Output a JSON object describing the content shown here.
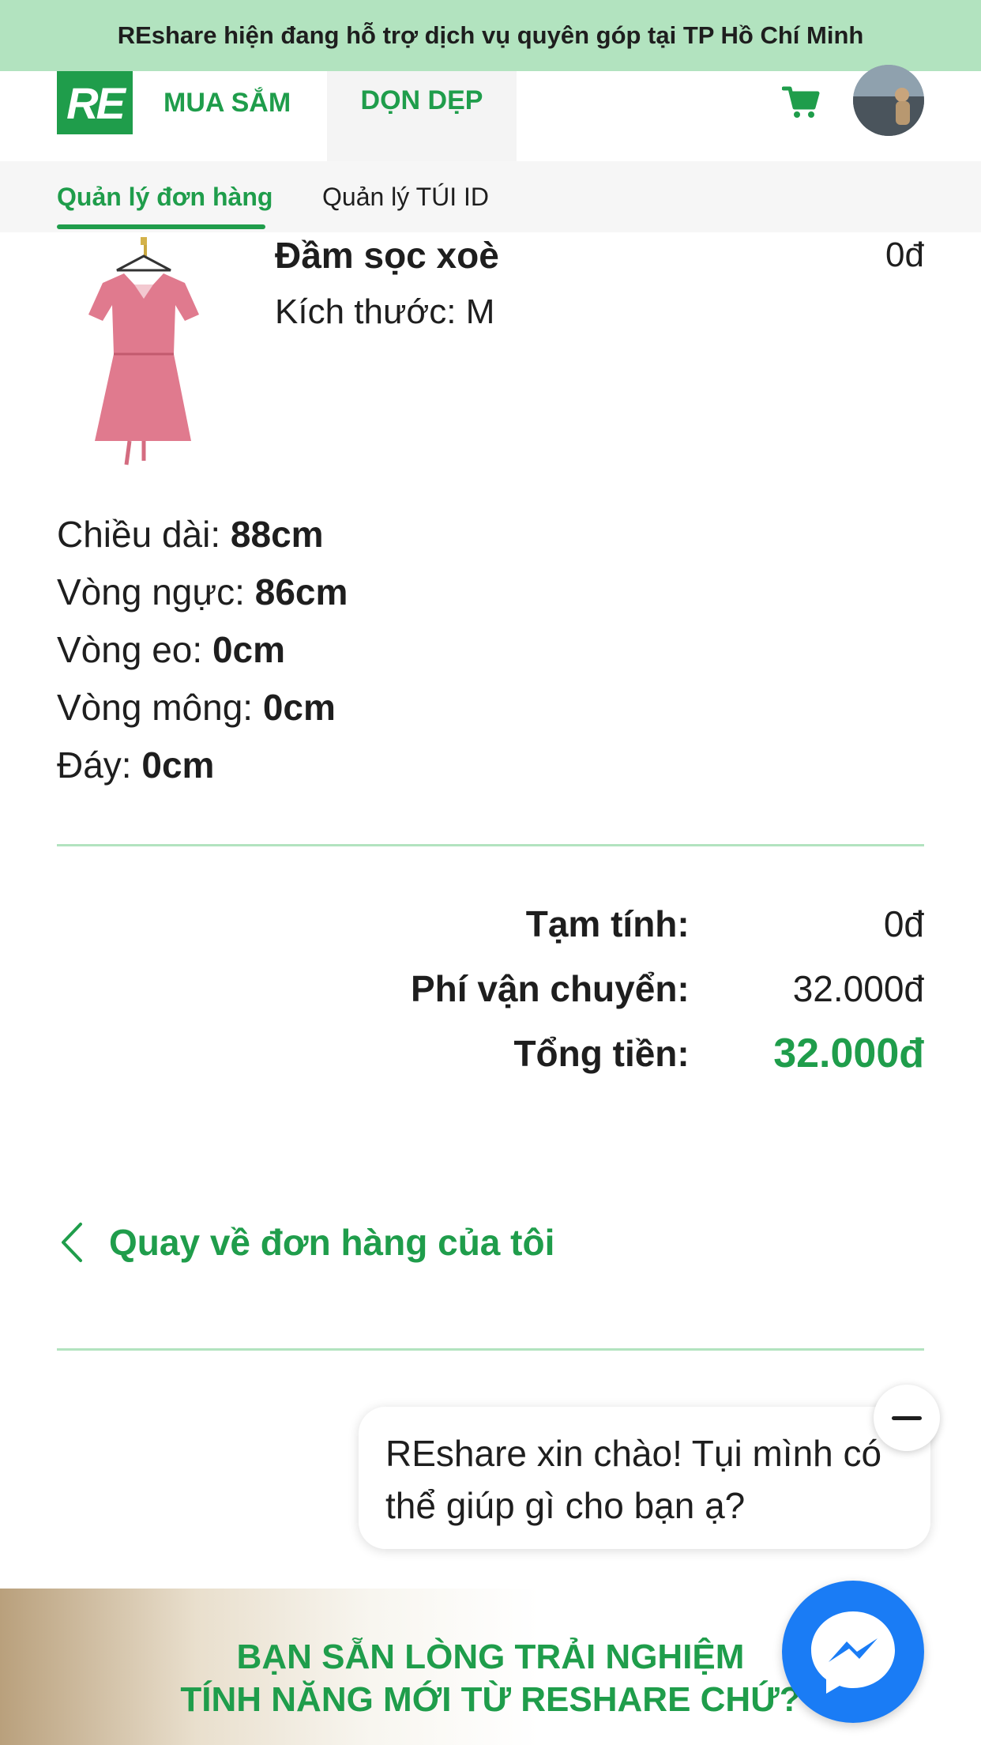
{
  "banner": {
    "text": "REshare hiện đang hỗ trợ dịch vụ quyên góp tại TP Hồ Chí Minh"
  },
  "header": {
    "logo_text": "RE",
    "nav": [
      {
        "label": "MUA SẮM"
      },
      {
        "label": "DỌN DẸP"
      }
    ],
    "cart_icon": "cart-icon",
    "avatar": "user-avatar"
  },
  "subnav": {
    "tabs": [
      {
        "label": "Quản lý đơn hàng",
        "active": true
      },
      {
        "label": "Quản lý TÚI ID",
        "active": false
      }
    ]
  },
  "product": {
    "name": "Đầm sọc xoè",
    "size_label": "Kích thước:",
    "size": "M",
    "price": "0đ"
  },
  "measurements": [
    {
      "label": "Chiều dài:",
      "value": "88cm"
    },
    {
      "label": "Vòng ngực:",
      "value": "86cm"
    },
    {
      "label": "Vòng eo:",
      "value": "0cm"
    },
    {
      "label": "Vòng mông:",
      "value": "0cm"
    },
    {
      "label": "Đáy:",
      "value": "0cm"
    }
  ],
  "totals": {
    "subtotal_label": "Tạm tính:",
    "subtotal": "0đ",
    "shipping_label": "Phí vận chuyển:",
    "shipping": "32.000đ",
    "total_label": "Tổng tiền:",
    "total": "32.000đ"
  },
  "back_link": {
    "label": "Quay về đơn hàng của tôi"
  },
  "chat": {
    "message": "REshare xin chào! Tụi mình có thể giúp gì cho bạn ạ?"
  },
  "promo": {
    "title_line1": "BẠN SẴN LÒNG TRẢI NGHIỆM",
    "title_line2": "TÍNH NĂNG MỚI TỪ RESHARE CHỨ?"
  },
  "colors": {
    "brand_green": "#1f9d4b",
    "banner_bg": "#b2e3bf",
    "messenger_blue": "#1a7cf5"
  }
}
